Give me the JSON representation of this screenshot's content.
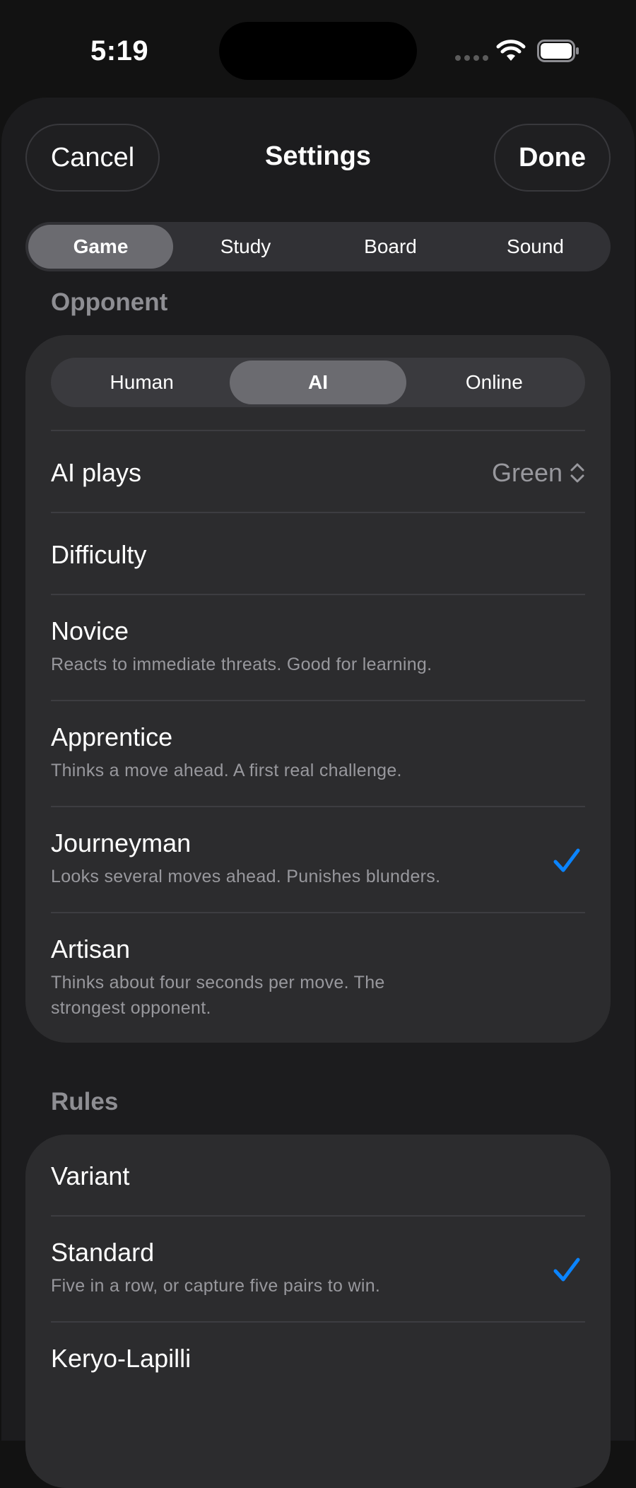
{
  "status": {
    "time": "5:19"
  },
  "nav": {
    "cancel_label": "Cancel",
    "title": "Settings",
    "done_label": "Done"
  },
  "tabs": [
    {
      "label": "Game",
      "selected": true
    },
    {
      "label": "Study",
      "selected": false
    },
    {
      "label": "Board",
      "selected": false
    },
    {
      "label": "Sound",
      "selected": false
    }
  ],
  "opponent": {
    "header": "Opponent",
    "modes": [
      {
        "label": "Human",
        "selected": false
      },
      {
        "label": "AI",
        "selected": true
      },
      {
        "label": "Online",
        "selected": false
      }
    ],
    "ai_plays_label": "AI plays",
    "ai_plays_value": "Green",
    "difficulty_label": "Difficulty",
    "levels": [
      {
        "title": "Novice",
        "subtitle": "Reacts to immediate threats. Good for learning.",
        "checked": false
      },
      {
        "title": "Apprentice",
        "subtitle": "Thinks a move ahead. A first real challenge.",
        "checked": false
      },
      {
        "title": "Journeyman",
        "subtitle": "Looks several moves ahead. Punishes blunders.",
        "checked": true
      },
      {
        "title": "Artisan",
        "subtitle": "Thinks about four seconds per move. The strongest opponent.",
        "checked": false
      }
    ]
  },
  "rules": {
    "header": "Rules",
    "variant_label": "Variant",
    "variants": [
      {
        "title": "Standard",
        "subtitle": "Five in a row, or capture five pairs to win.",
        "checked": true
      },
      {
        "title": "Keryo-Lapilli",
        "subtitle": "",
        "checked": false
      }
    ]
  },
  "colors": {
    "accent": "#0a84ff",
    "background": "#1c1c1e",
    "card": "#2c2c2e"
  }
}
